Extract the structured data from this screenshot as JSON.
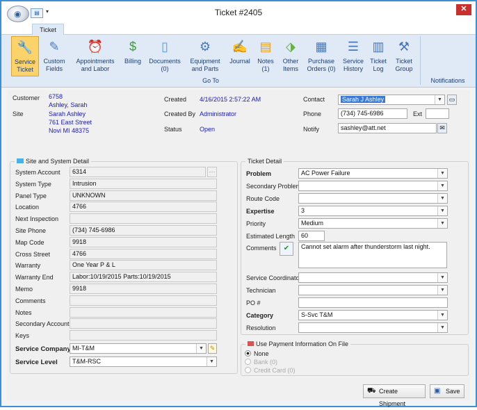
{
  "window": {
    "title": "Ticket #2405",
    "close": "✕"
  },
  "ribbon": {
    "tab": "Ticket",
    "group": "Go To",
    "notifications": "Notifications",
    "buttons": [
      {
        "l1": "Service",
        "l2": "Ticket",
        "name": "service-ticket-button",
        "icon": "wrench-icon"
      },
      {
        "l1": "Custom",
        "l2": "Fields",
        "name": "custom-fields-button",
        "icon": "pencil-form-icon"
      },
      {
        "l1": "Appointments",
        "l2": "and Labor",
        "name": "appointments-labor-button",
        "icon": "alarm-clock-icon"
      },
      {
        "l1": "Billing",
        "l2": "",
        "name": "billing-button",
        "icon": "dollar-icon"
      },
      {
        "l1": "Documents",
        "l2": "(0)",
        "name": "documents-button",
        "icon": "document-icon"
      },
      {
        "l1": "Equipment",
        "l2": "and Parts",
        "name": "equipment-parts-button",
        "icon": "gear-icon"
      },
      {
        "l1": "Journal",
        "l2": "",
        "name": "journal-button",
        "icon": "journal-icon"
      },
      {
        "l1": "Notes",
        "l2": "(1)",
        "name": "notes-button",
        "icon": "note-icon"
      },
      {
        "l1": "Other",
        "l2": "Items",
        "name": "other-items-button",
        "icon": "tag-icon"
      },
      {
        "l1": "Purchase",
        "l2": "Orders (0)",
        "name": "purchase-orders-button",
        "icon": "purchase-order-icon"
      },
      {
        "l1": "Service",
        "l2": "History",
        "name": "service-history-button",
        "icon": "history-icon"
      },
      {
        "l1": "Ticket",
        "l2": "Log",
        "name": "ticket-log-button",
        "icon": "log-icon"
      },
      {
        "l1": "Ticket",
        "l2": "Group",
        "name": "ticket-group-button",
        "icon": "group-icon"
      }
    ]
  },
  "header": {
    "customer_label": "Customer",
    "customer_num": "6758",
    "customer_name": "Ashley, Sarah",
    "site_label": "Site",
    "site_name": "Sarah Ashley",
    "site_addr": "761 East Street",
    "site_city": "Novi MI 48375",
    "created_label": "Created",
    "created": "4/16/2015 2:57:22 AM",
    "createdby_label": "Created By",
    "createdby": "Administrator",
    "status_label": "Status",
    "status": "Open",
    "contact_label": "Contact",
    "contact": "Sarah J Ashley",
    "phone_label": "Phone",
    "phone": "(734) 745-6986",
    "ext_label": "Ext",
    "notify_label": "Notify",
    "notify": "sashley@att.net"
  },
  "site_detail": {
    "title": "Site and System Detail",
    "fields": [
      {
        "label": "System Account",
        "value": "6314"
      },
      {
        "label": "System Type",
        "value": "Intrusion"
      },
      {
        "label": "Panel Type",
        "value": "UNKNOWN"
      },
      {
        "label": "Location",
        "value": "4766"
      },
      {
        "label": "Next Inspection",
        "value": ""
      },
      {
        "label": "Site Phone",
        "value": "(734) 745-6986"
      },
      {
        "label": "Map Code",
        "value": "9918"
      },
      {
        "label": "Cross Street",
        "value": "4766"
      },
      {
        "label": "Warranty",
        "value": "One Year P & L"
      },
      {
        "label": "Warranty End",
        "value": "Labor:10/19/2015 Parts:10/19/2015"
      },
      {
        "label": "Memo",
        "value": "9918"
      },
      {
        "label": "Comments",
        "value": ""
      },
      {
        "label": "Notes",
        "value": ""
      },
      {
        "label": "Secondary Account",
        "value": ""
      },
      {
        "label": "Keys",
        "value": ""
      }
    ],
    "service_company_label": "Service Company",
    "service_company": "MI-T&M",
    "service_level_label": "Service Level",
    "service_level": "T&M-RSC"
  },
  "ticket_detail": {
    "title": "Ticket Detail",
    "problem_label": "Problem",
    "problem": "AC Power Failure",
    "secondary_label": "Secondary Problem",
    "secondary": "",
    "route_label": "Route Code",
    "route": "",
    "expertise_label": "Expertise",
    "expertise": "3",
    "priority_label": "Priority",
    "priority": "Medium",
    "estlen_label": "Estimated Length",
    "estlen": "60",
    "comments_label": "Comments",
    "comments": "Cannot set alarm after thunderstorm last night.",
    "coord_label": "Service Coordinator",
    "coord": "",
    "tech_label": "Technician",
    "tech": "",
    "po_label": "PO #",
    "po": "",
    "category_label": "Category",
    "category": "S-Svc T&M",
    "resolution_label": "Resolution",
    "resolution": ""
  },
  "payment": {
    "title": "Use Payment Information On File",
    "none": "None",
    "bank": "Bank (0)",
    "credit": "Credit Card (0)"
  },
  "footer": {
    "create_shipment": "Create Shipment",
    "save": "Save"
  },
  "colors": {
    "accent": "#3c8fd8",
    "value_text": "#1a1ab0",
    "ribbon_bg": "#dfeaf6",
    "active_button": "#fbd36a"
  }
}
